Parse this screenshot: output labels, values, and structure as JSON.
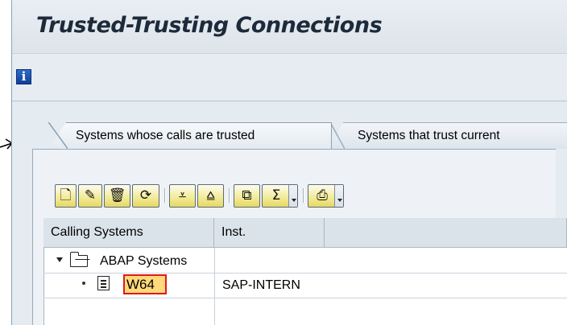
{
  "window": {
    "title": "Trusted-Trusting Connections"
  },
  "appbar": {
    "info_icon": "info-icon",
    "info_glyph": "i"
  },
  "tabs": [
    {
      "label": "Systems whose calls are trusted",
      "active": true
    },
    {
      "label": "Systems that trust current",
      "active": false
    }
  ],
  "toolbar": {
    "buttons": [
      {
        "name": "create-icon",
        "glyph": "🗋"
      },
      {
        "name": "change-icon",
        "glyph": "✎"
      },
      {
        "name": "delete-icon",
        "glyph": "🗑"
      },
      {
        "name": "refresh-icon",
        "glyph": "⟳"
      },
      {
        "name": "expand-all-icon",
        "glyph": "⩡"
      },
      {
        "name": "collapse-all-icon",
        "glyph": "⩠"
      },
      {
        "name": "find-icon",
        "glyph": "⧉"
      },
      {
        "name": "sum-icon",
        "glyph": "Σ"
      },
      {
        "name": "print-icon",
        "glyph": "⎙"
      }
    ]
  },
  "table": {
    "columns": [
      "Calling Systems",
      "Inst."
    ],
    "rows": [
      {
        "level": 0,
        "expanded": true,
        "icon": "folder-icon",
        "system": "ABAP Systems",
        "inst": ""
      },
      {
        "level": 1,
        "icon": "document-icon",
        "system": "W64",
        "inst": "SAP-INTERN",
        "selected": true
      }
    ]
  },
  "colors": {
    "window_bg": "#dfe6ed",
    "button_gradient_top": "#fdfcf0",
    "button_gradient_bottom": "#e6d762",
    "selection_fill": "#ffd97a",
    "selection_border": "#e31919",
    "info_blue": "#1f56b5"
  }
}
